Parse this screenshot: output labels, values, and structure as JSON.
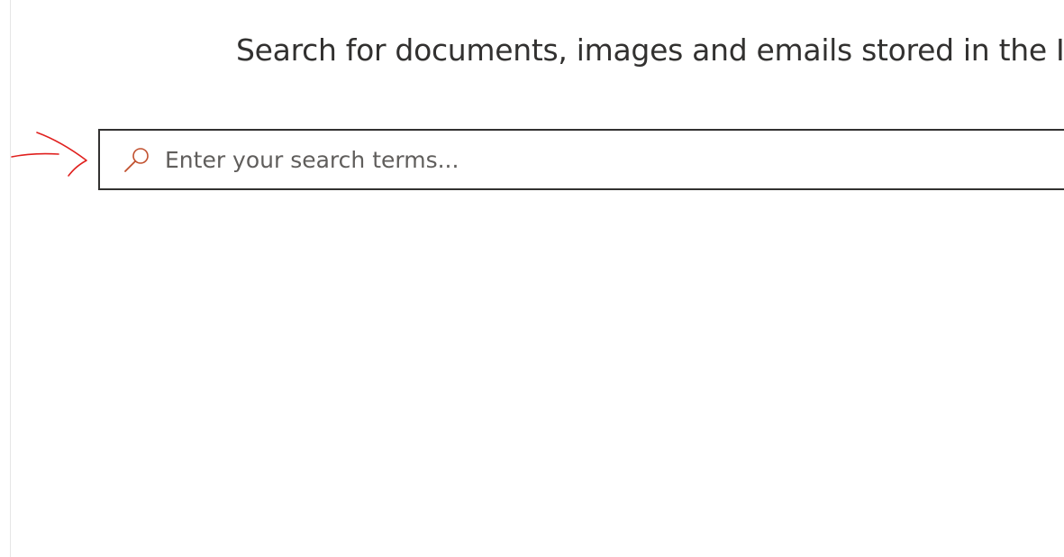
{
  "page": {
    "headline": "Search for documents, images and emails stored in the IM"
  },
  "search": {
    "placeholder": "Enter your search terms...",
    "value": "",
    "icon": "search-icon",
    "accent_color": "#c1502e"
  },
  "annotation": {
    "icon": "red-arrow-annotation",
    "color": "#e0201e"
  }
}
